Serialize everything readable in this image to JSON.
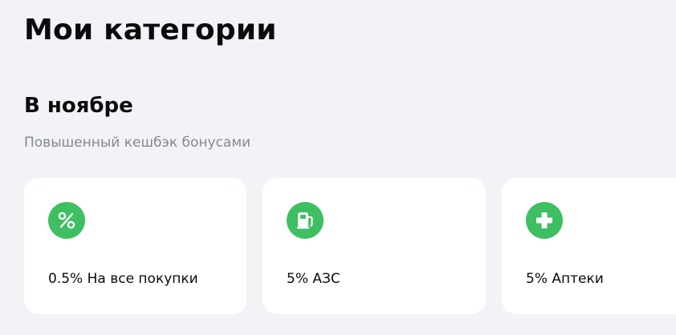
{
  "page": {
    "title": "Мои категории"
  },
  "section": {
    "title": "В ноябре",
    "subtitle": "Повышенный кешбэк бонусами"
  },
  "categories": [
    {
      "label": "0.5% На все покупки",
      "icon": "percent-icon"
    },
    {
      "label": "5% АЗС",
      "icon": "fuel-pump-icon"
    },
    {
      "label": "5% Аптеки",
      "icon": "pharmacy-cross-icon"
    }
  ],
  "colors": {
    "background": "#f2f3f7",
    "card": "#ffffff",
    "accent_green": "#3dbf62",
    "subtitle_gray": "#858792"
  }
}
